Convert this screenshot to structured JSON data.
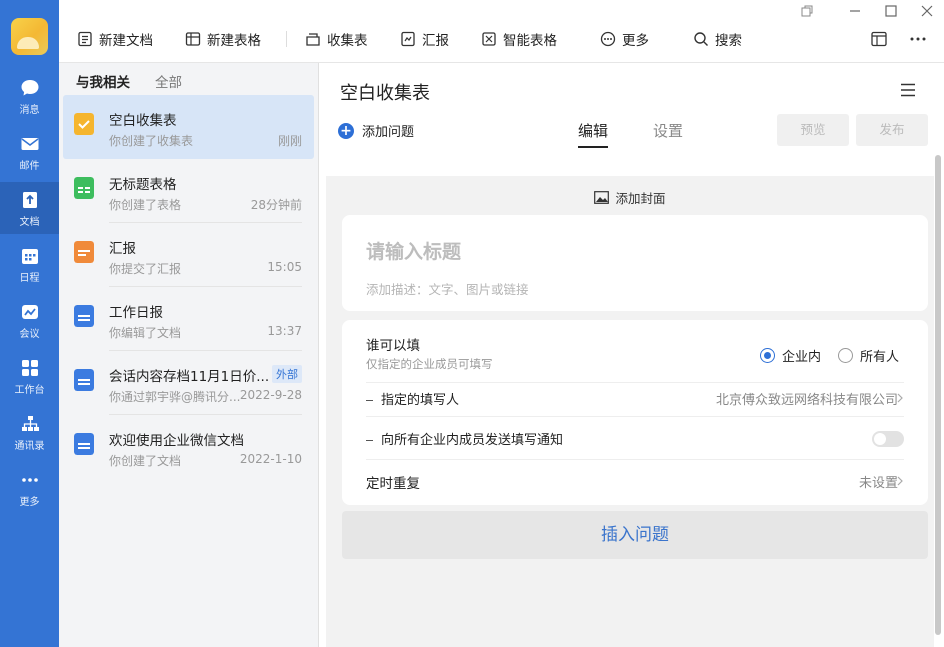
{
  "rail": {
    "items": [
      {
        "label": "消息",
        "icon": "chat-icon"
      },
      {
        "label": "邮件",
        "icon": "mail-icon"
      },
      {
        "label": "文档",
        "icon": "doc-icon"
      },
      {
        "label": "日程",
        "icon": "calendar-icon"
      },
      {
        "label": "会议",
        "icon": "meeting-icon"
      },
      {
        "label": "工作台",
        "icon": "grid-icon"
      },
      {
        "label": "通讯录",
        "icon": "contacts-icon"
      },
      {
        "label": "更多",
        "icon": "more-icon"
      }
    ],
    "active": "文档"
  },
  "toolbar": {
    "new_doc": "新建文档",
    "new_sheet": "新建表格",
    "form": "收集表",
    "report": "汇报",
    "smart_sheet": "智能表格",
    "more": "更多",
    "search": "搜索"
  },
  "list": {
    "tabs": [
      "与我相关",
      "全部"
    ],
    "items": [
      {
        "title": "空白收集表",
        "sub": "你创建了收集表",
        "time": "刚刚",
        "icon": "form-icon",
        "color": "#f5b52e"
      },
      {
        "title": "无标题表格",
        "sub": "你创建了表格",
        "time": "28分钟前",
        "icon": "sheet-icon",
        "color": "#3dbd5e"
      },
      {
        "title": "汇报",
        "sub": "你提交了汇报",
        "time": "15:05",
        "icon": "report-icon",
        "color": "#f08a3a"
      },
      {
        "title": "工作日报",
        "sub": "你编辑了文档",
        "time": "13:37",
        "icon": "doc-icon",
        "color": "#3b7be0"
      },
      {
        "title": "会话内容存档11月1日价...",
        "sub": "你通过郭宇骅@腾讯分...",
        "time": "2022-9-28",
        "badge": "外部",
        "icon": "doc-icon",
        "color": "#3b7be0"
      },
      {
        "title": "欢迎使用企业微信文档",
        "sub": "你创建了文档",
        "time": "2022-1-10",
        "icon": "doc-icon",
        "color": "#3b7be0"
      }
    ]
  },
  "content": {
    "title": "空白收集表",
    "add_question": "添加问题",
    "tabs": [
      "编辑",
      "设置"
    ],
    "preview": "预览",
    "publish": "发布",
    "add_cover": "添加封面",
    "form_title_placeholder": "请输入标题",
    "form_desc_placeholder": "添加描述：文字、图片或链接",
    "who_can_fill": "谁可以填",
    "who_can_fill_sub": "仅指定的企业成员可填写",
    "opt_internal": "企业内",
    "opt_everyone": "所有人",
    "assigned_fillers": "指定的填写人",
    "company": "北京傅众致远网络科技有限公司",
    "notify_all": "向所有企业内成员发送填写通知",
    "schedule_repeat": "定时重复",
    "not_set": "未设置",
    "insert_question": "插入问题"
  }
}
